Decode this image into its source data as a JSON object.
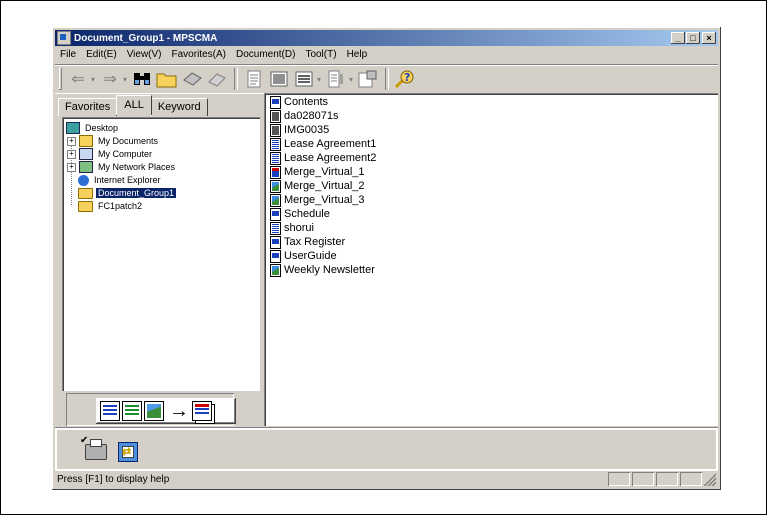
{
  "window": {
    "title": "Document_Group1 - MPSCMA"
  },
  "menubar": {
    "items": [
      "File",
      "Edit(E)",
      "View(V)",
      "Favorites(A)",
      "Document(D)",
      "Tool(T)",
      "Help"
    ]
  },
  "toolbar": {
    "buttons": [
      "back-icon",
      "forward-icon",
      "binoculars-icon",
      "folder-open-icon",
      "print-icon",
      "fax-icon",
      "properties-icon",
      "thumbnail-icon",
      "list-view-icon",
      "merge-icon",
      "document-settings-icon",
      "help-icon"
    ]
  },
  "tabs": [
    {
      "label": "Favorites"
    },
    {
      "label": "ALL"
    },
    {
      "label": "Keyword"
    }
  ],
  "tree": {
    "items": [
      {
        "label": "Desktop",
        "icon": "desktop-icon"
      },
      {
        "label": "My Documents",
        "icon": "my-documents-icon"
      },
      {
        "label": "My Computer",
        "icon": "my-computer-icon"
      },
      {
        "label": "My Network Places",
        "icon": "network-places-icon"
      },
      {
        "label": "Internet Explorer",
        "icon": "internet-explorer-icon"
      },
      {
        "label": "Document_Group1",
        "icon": "folder-icon",
        "selected": true
      },
      {
        "label": "FC1patch2",
        "icon": "folder-icon"
      }
    ]
  },
  "files": [
    {
      "name": "Contents",
      "icon": "page"
    },
    {
      "name": "da028071s",
      "icon": "scan"
    },
    {
      "name": "IMG0035",
      "icon": "scan"
    },
    {
      "name": "Lease Agreement1",
      "icon": "text"
    },
    {
      "name": "Lease Agreement2",
      "icon": "text"
    },
    {
      "name": "Merge_Virtual_1",
      "icon": "merge"
    },
    {
      "name": "Merge_Virtual_2",
      "icon": "img"
    },
    {
      "name": "Merge_Virtual_3",
      "icon": "img"
    },
    {
      "name": "Schedule",
      "icon": "page"
    },
    {
      "name": "shorui",
      "icon": "text"
    },
    {
      "name": "Tax Register",
      "icon": "page"
    },
    {
      "name": "UserGuide",
      "icon": "page"
    },
    {
      "name": "Weekly Newsletter",
      "icon": "img"
    }
  ],
  "statusbar": {
    "text": "Press [F1] to display help"
  }
}
